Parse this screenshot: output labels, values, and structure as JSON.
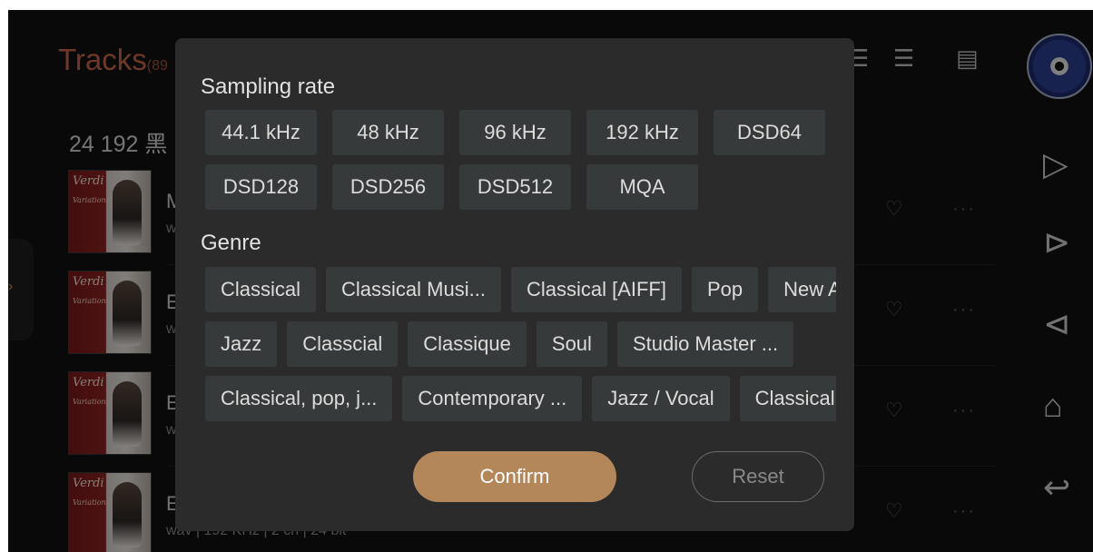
{
  "header": {
    "title": "Tracks",
    "count": "(89",
    "album": "24 192 黑"
  },
  "tracks": [
    {
      "cover_title": "Verdi",
      "cover_sub": "Variations",
      "name": "M",
      "meta": "w"
    },
    {
      "cover_title": "Verdi",
      "cover_sub": "Variations",
      "name": "E",
      "meta": "w"
    },
    {
      "cover_title": "Verdi",
      "cover_sub": "Variations",
      "name": "E",
      "meta": "w"
    },
    {
      "cover_title": "Verdi",
      "cover_sub": "Variations",
      "name": "E",
      "meta": "wav | 192 KHz | 2 ch | 24 bit"
    }
  ],
  "filter": {
    "sampling_rate": {
      "title": "Sampling rate",
      "rows": [
        [
          "44.1 kHz",
          "48 kHz",
          "96 kHz",
          "192 kHz",
          "DSD64"
        ],
        [
          "DSD128",
          "DSD256",
          "DSD512",
          "MQA"
        ]
      ]
    },
    "genre": {
      "title": "Genre",
      "rows": [
        [
          "Classical",
          "Classical Musi...",
          "Classical [AIFF]",
          "Pop",
          "New Age"
        ],
        [
          "Jazz",
          "Classcial",
          "Classique",
          "Soul",
          "Studio Master ..."
        ],
        [
          "Classical, pop, j...",
          "Contemporary ...",
          "Jazz / Vocal",
          "Classical"
        ]
      ]
    },
    "confirm_label": "Confirm",
    "reset_label": "Reset"
  },
  "icons": {
    "filter": "filter-icon",
    "sort": "sort-icon",
    "view": "view-mode-icon",
    "play": "play-icon",
    "next": "skip-next-icon",
    "prev": "skip-previous-icon",
    "home": "home-icon",
    "back": "back-icon"
  },
  "colors": {
    "accent": "#b38759",
    "title": "#c9674b",
    "dialog_bg": "#2b2b2b",
    "chip_bg": "#373a3a"
  }
}
